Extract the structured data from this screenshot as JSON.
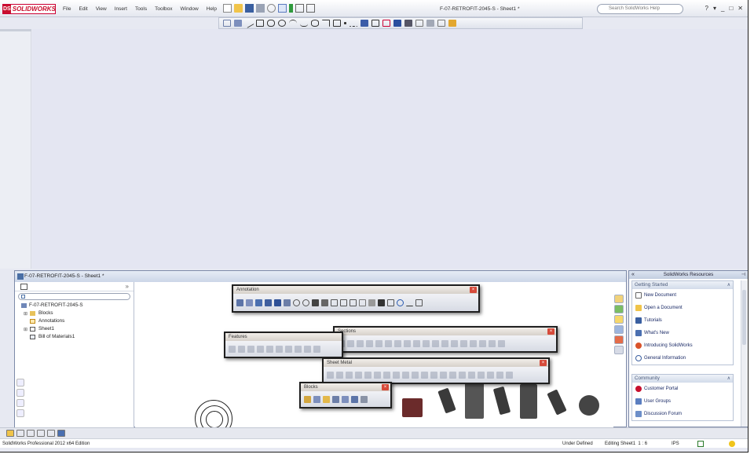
{
  "app": {
    "brand": "SOLIDWORKS",
    "doc_title": "F-07-RETROFIT-2045-S - Sheet1 *",
    "search_placeholder": "Search SolidWorks Help",
    "menus": [
      "File",
      "Edit",
      "View",
      "Insert",
      "Tools",
      "Toolbox",
      "Window",
      "Help"
    ],
    "window_controls": [
      "?",
      "▾",
      "_",
      "□",
      "✕"
    ]
  },
  "document": {
    "window_title": "F-07-RETROFIT-2045-S - Sheet1 *",
    "tree": {
      "root": "F-07-RETROFIT-2045-S",
      "items": [
        {
          "label": "Blocks",
          "level": 1
        },
        {
          "label": "Annotations",
          "level": 1
        },
        {
          "label": "Sheet1",
          "level": 1
        },
        {
          "label": "Bill of Materials1",
          "level": 1
        }
      ]
    }
  },
  "palettes": {
    "annotation": "Annotation",
    "sections": "Sections",
    "features": "Features",
    "sheet_metal": "Sheet Metal",
    "blocks": "Blocks"
  },
  "resources": {
    "title": "SolidWorks Resources",
    "getting_started": {
      "heading": "Getting Started",
      "items": [
        "New Document",
        "Open a Document",
        "Tutorials",
        "What's New",
        "Introducing SolidWorks",
        "General Information"
      ]
    },
    "community": {
      "heading": "Community",
      "items": [
        "Customer Portal",
        "User Groups",
        "Discussion Forum"
      ]
    }
  },
  "status": {
    "edition": "SolidWorks Professional 2012 x64 Edition",
    "definition": "Under Defined",
    "editing": "Editing Sheet1",
    "scale": "1 : 6",
    "units": "IPS"
  },
  "colors": {
    "brand_red": "#c8102e",
    "workspace": "#e4e6f2",
    "palette_border": "#3b3b3b"
  }
}
